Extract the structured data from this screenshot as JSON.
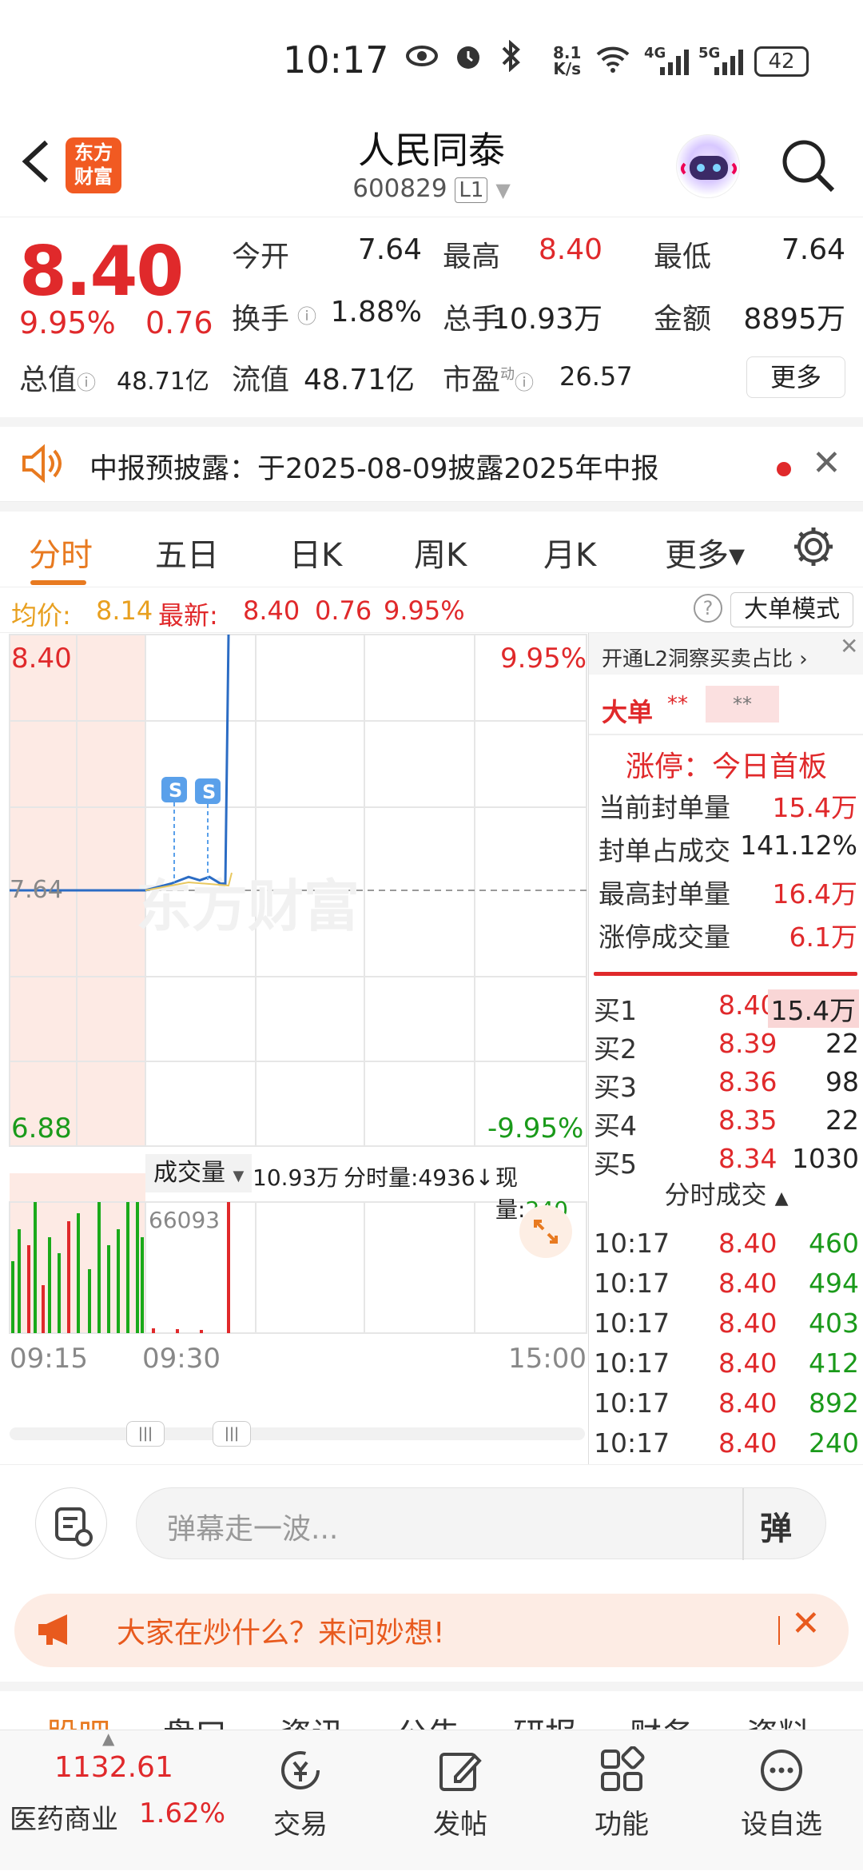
{
  "status_bar": {
    "time": "10:17",
    "net_speed_top": "8.1",
    "net_speed_bottom": "K/s",
    "sig1": "4G",
    "sig2": "5G",
    "battery": "42"
  },
  "header": {
    "back_icon": "chevron-left-icon",
    "logo_text_1": "东方",
    "logo_text_2": "财富",
    "title": "人民同泰",
    "code": "600829",
    "level": "L1"
  },
  "quote": {
    "price": "8.40",
    "pct": "9.95%",
    "change": "0.76",
    "stats": [
      {
        "label": "今开",
        "value": "7.64",
        "color": "#222222"
      },
      {
        "label": "最高",
        "value": "8.40",
        "color": "#e0292b"
      },
      {
        "label": "最低",
        "value": "7.64",
        "color": "#222222"
      },
      {
        "label": "换手",
        "value": "1.88%",
        "color": "#222222"
      },
      {
        "label": "总手",
        "value": "10.93万",
        "color": "#222222"
      },
      {
        "label": "金额",
        "value": "8895万",
        "color": "#222222"
      }
    ],
    "total_value_label": "总值",
    "total_value": "48.71亿",
    "float_value_label": "流值",
    "float_value": "48.71亿",
    "pe_label": "市盈",
    "pe_sup": "动",
    "pe_value": "26.57",
    "more_label": "更多"
  },
  "notice": {
    "text": "中报预披露：于2025-08-09披露2025年中报"
  },
  "tabs": [
    {
      "label": "分时"
    },
    {
      "label": "五日"
    },
    {
      "label": "日K"
    },
    {
      "label": "周K"
    },
    {
      "label": "月K"
    },
    {
      "label": "更多▾"
    }
  ],
  "info_row": {
    "avg_label": "均价:",
    "avg_value": "8.14",
    "latest_label": "最新:",
    "latest_value": "8.40",
    "latest_change": "0.76",
    "latest_pct": "9.95%",
    "big_order_mode": "大单模式"
  },
  "chart": {
    "top_price": "8.40",
    "top_pct": "9.95%",
    "mid_price": "7.64",
    "bottom_price": "6.88",
    "bottom_pct": "-9.95%",
    "s_marker": "S",
    "watermark": "东方财富",
    "volume_dropdown": "成交量",
    "volume_total": "10.93万",
    "tick_vol_label": "分时量:4936↓",
    "now_vol_label": "现量:",
    "now_vol": "240",
    "vol_max": "66093",
    "time_start": "09:15",
    "time_mid": "09:30",
    "time_end": "15:00",
    "accent": "#2b6cc4"
  },
  "chart_data": {
    "type": "line",
    "title": "",
    "ylim": [
      6.88,
      8.4
    ],
    "reference_price": 7.64,
    "x": [
      "09:15",
      "09:25",
      "09:30",
      "09:40",
      "09:50",
      "10:00",
      "10:10",
      "10:15",
      "10:16",
      "10:17"
    ],
    "series": [
      {
        "values": [
          7.64,
          7.64,
          7.64,
          7.66,
          7.68,
          7.67,
          7.68,
          7.66,
          7.66,
          8.4
        ]
      }
    ]
  },
  "rpanel": {
    "l2_link": "开通L2洞察买卖占比 ›",
    "big_label": "大单",
    "big_stars1": "**",
    "big_stars2": "**",
    "limit_up_title": "涨停：今日首板",
    "stats": [
      {
        "label": "当前封单量",
        "value": "15.4万",
        "color": "#e0292b"
      },
      {
        "label": "封单占成交",
        "value": "141.12%",
        "color": "#222222"
      },
      {
        "label": "最高封单量",
        "value": "16.4万",
        "color": "#e0292b"
      },
      {
        "label": "涨停成交量",
        "value": "6.1万",
        "color": "#e0292b"
      }
    ],
    "buys": [
      {
        "label": "买1",
        "price": "8.40",
        "vol": "15.4万"
      },
      {
        "label": "买2",
        "price": "8.39",
        "vol": "22"
      },
      {
        "label": "买3",
        "price": "8.36",
        "vol": "98"
      },
      {
        "label": "买4",
        "price": "8.35",
        "vol": "22"
      },
      {
        "label": "买5",
        "price": "8.34",
        "vol": "1030"
      }
    ],
    "ticks_title": "分时成交",
    "ticks": [
      {
        "time": "10:17",
        "price": "8.40",
        "vol": "460"
      },
      {
        "time": "10:17",
        "price": "8.40",
        "vol": "494"
      },
      {
        "time": "10:17",
        "price": "8.40",
        "vol": "403"
      },
      {
        "time": "10:17",
        "price": "8.40",
        "vol": "412"
      },
      {
        "time": "10:17",
        "price": "8.40",
        "vol": "892"
      },
      {
        "time": "10:17",
        "price": "8.40",
        "vol": "240"
      }
    ]
  },
  "danmu": {
    "placeholder": "弹幕走一波...",
    "send_label": "弹"
  },
  "ad": {
    "text": "大家在炒什么？来问妙想!"
  },
  "bottom_tabs": [
    "股吧",
    "盘口",
    "资讯",
    "公告",
    "研报",
    "财务",
    "资料"
  ],
  "bottom_nav": {
    "index_value": "1132.61",
    "index_name": "医药商业",
    "index_pct": "1.62%",
    "items": [
      {
        "label": "交易"
      },
      {
        "label": "发帖"
      },
      {
        "label": "功能"
      },
      {
        "label": "设自选"
      }
    ]
  }
}
